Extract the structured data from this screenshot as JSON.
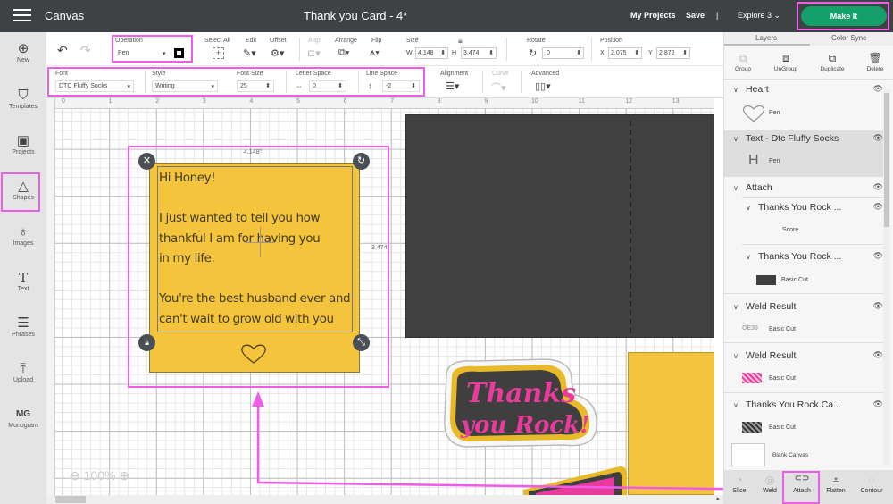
{
  "topbar": {
    "menu_icon": "hamburger-icon",
    "app_name": "Canvas",
    "doc_title": "Thank you Card - 4*",
    "my_projects": "My Projects",
    "save": "Save",
    "divider": "|",
    "machine": "Explore 3",
    "make_it": "Make It",
    "accent": "#14a06a"
  },
  "left_nav": [
    {
      "label": "New",
      "icon": "plus-circle-icon",
      "glyph": "⊕"
    },
    {
      "label": "Templates",
      "icon": "tshirt-icon",
      "glyph": "👕"
    },
    {
      "label": "Projects",
      "icon": "projects-icon",
      "glyph": "▣"
    },
    {
      "label": "Shapes",
      "icon": "shapes-icon",
      "glyph": "△"
    },
    {
      "label": "Images",
      "icon": "lightbulb-icon",
      "glyph": "♁"
    },
    {
      "label": "Text",
      "icon": "text-icon",
      "glyph": "T"
    },
    {
      "label": "Phrases",
      "icon": "speech-bubble-icon",
      "glyph": "☰"
    },
    {
      "label": "Upload",
      "icon": "upload-icon",
      "glyph": "⤒"
    },
    {
      "label": "Monogram",
      "icon": "monogram-icon",
      "glyph": "MG"
    }
  ],
  "toolbar": {
    "operation_label": "Operation",
    "operation_value": "Pen",
    "select_all": "Select All",
    "edit": "Edit",
    "offset": "Offset",
    "align": "Align",
    "arrange": "Arrange",
    "flip": "Flip",
    "size": "Size",
    "w_label": "W",
    "w_value": "4.148",
    "h_label": "H",
    "h_value": "3.474",
    "rotate": "Rotate",
    "rotate_value": "0",
    "position": "Position",
    "x_label": "X",
    "x_value": "2.075",
    "y_label": "Y",
    "y_value": "2.872"
  },
  "text_toolbar": {
    "font_label": "Font",
    "font_value": "DTC Fluffy Socks",
    "style_label": "Style",
    "style_value": "Writing",
    "font_size_label": "Font Size",
    "font_size_value": "25",
    "letter_space_label": "Letter Space",
    "letter_space_value": "0",
    "line_space_label": "Line Space",
    "line_space_value": "-2",
    "alignment_label": "Alignment",
    "curve_label": "Curve",
    "advanced_label": "Advanced"
  },
  "ruler": {
    "h_ticks": [
      "0",
      "1",
      "2",
      "3",
      "4",
      "5",
      "6",
      "7",
      "8",
      "9",
      "10",
      "11",
      "12",
      "13"
    ]
  },
  "canvas": {
    "card_message": "Hi Honey!\n\nI just wanted to tell you how\nthankful I am for having you\nin my life.\n\nYou're the best husband ever and\ncan't wait to grow old with you",
    "width_dim": "4.148\"",
    "height_dim": "3.474\"",
    "card_color": "#f4c43c",
    "dark_card_color": "#404040",
    "sticker_text_1": "Thanks",
    "sticker_text_2": "you Rock!",
    "sticker_pink": "#e83b9c",
    "zoom_level": "100%"
  },
  "right_panel": {
    "tabs": [
      "Layers",
      "Color Sync"
    ],
    "tools": [
      {
        "label": "Group",
        "icon": "group-icon",
        "glyph": "⧉",
        "disabled": true
      },
      {
        "label": "UnGroup",
        "icon": "ungroup-icon",
        "glyph": "⧈",
        "disabled": false
      },
      {
        "label": "Duplicate",
        "icon": "duplicate-icon",
        "glyph": "⧉",
        "disabled": false
      },
      {
        "label": "Delete",
        "icon": "trash-icon",
        "glyph": "🗑",
        "disabled": false
      }
    ],
    "layers": [
      {
        "name": "Heart",
        "sub": "Pen"
      },
      {
        "name": "Text - Dtc Fluffy Socks",
        "sub": "Pen"
      },
      {
        "name": "Attach"
      },
      {
        "name": "Thanks You Rock ...",
        "sub": "Score"
      },
      {
        "name": "Thanks You Rock ...",
        "sub": "Basic Cut"
      },
      {
        "name": "Weld Result",
        "sub": "Basic Cut"
      },
      {
        "name": "Weld Result",
        "sub": "Basic Cut"
      },
      {
        "name": "Thanks You Rock Ca...",
        "sub": "Basic Cut"
      }
    ],
    "blank_canvas": "Blank Canvas",
    "bottom_tools": [
      {
        "label": "Slice",
        "icon": "slice-icon",
        "glyph": "◔",
        "disabled": true
      },
      {
        "label": "Weld",
        "icon": "weld-icon",
        "glyph": "◎",
        "disabled": true
      },
      {
        "label": "Attach",
        "icon": "attach-icon",
        "glyph": "⊂⊃",
        "disabled": false
      },
      {
        "label": "Flatten",
        "icon": "flatten-icon",
        "glyph": "⩡",
        "disabled": false
      },
      {
        "label": "Contour",
        "icon": "contour-icon",
        "glyph": "◌",
        "disabled": true
      }
    ]
  },
  "annotation_color": "#ee5ce9"
}
